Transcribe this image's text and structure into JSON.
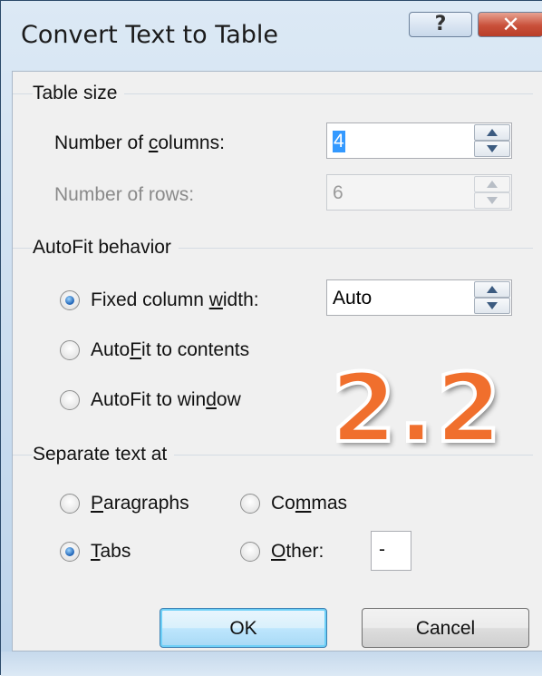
{
  "window": {
    "title": "Convert Text to Table",
    "help_glyph": "?",
    "close_glyph": "✕"
  },
  "table_size": {
    "group_label": "Table size",
    "columns_label_pre": "Number of ",
    "columns_label_key": "c",
    "columns_label_post": "olumns:",
    "columns_value": "4",
    "rows_label": "Number of rows:",
    "rows_value": "6"
  },
  "autofit": {
    "group_label": "AutoFit behavior",
    "fixed_pre": "Fixed column ",
    "fixed_key": "w",
    "fixed_post": "idth:",
    "fixed_value": "Auto",
    "contents_pre": "Auto",
    "contents_key": "F",
    "contents_post": "it to contents",
    "window_pre": "AutoFit to win",
    "window_key": "d",
    "window_post": "ow",
    "selected": "fixed"
  },
  "separate": {
    "group_label": "Separate text at",
    "paragraphs_key": "P",
    "paragraphs_rest": "aragraphs",
    "commas_pre": "Co",
    "commas_key": "m",
    "commas_post": "mas",
    "tabs_key": "T",
    "tabs_rest": "abs",
    "other_key": "O",
    "other_rest": "ther:",
    "other_value": "-",
    "selected": "tabs"
  },
  "buttons": {
    "ok": "OK",
    "cancel": "Cancel"
  },
  "overlay_label": "2.2",
  "icons": {
    "help": "help-icon",
    "close": "close-icon",
    "spin_up": "spin-up-icon",
    "spin_down": "spin-down-icon"
  }
}
